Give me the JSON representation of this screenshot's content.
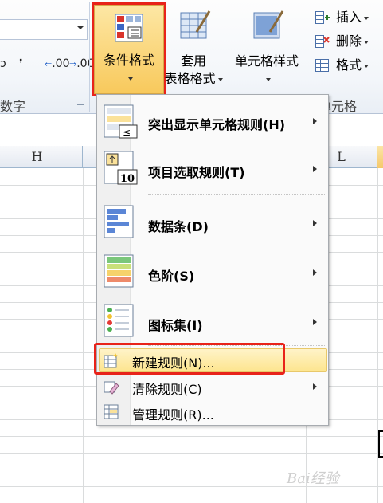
{
  "ribbon": {
    "number_group_label": "数字",
    "increase_decimal": ".00",
    "decrease_decimal": ".00",
    "comma_glyph": "❜",
    "conditional_format": {
      "label": "条件格式"
    },
    "format_as_table": {
      "label_line1": "套用",
      "label_line2": "表格格式"
    },
    "cell_styles": {
      "label": "单元格样式"
    },
    "cells_group_label": "单元格",
    "insert_label": "插入",
    "delete_label": "删除",
    "format_label": "格式"
  },
  "sheet": {
    "columns": [
      "H",
      "L"
    ],
    "highlight_color": "#f5c86a"
  },
  "menu": {
    "items": [
      {
        "label": "突出显示单元格规则(H)",
        "icon": "highlight-rules-icon",
        "has_submenu": true
      },
      {
        "label": "项目选取规则(T)",
        "icon": "top-bottom-rules-icon",
        "has_submenu": true
      },
      {
        "label": "数据条(D)",
        "icon": "data-bars-icon",
        "has_submenu": true
      },
      {
        "label": "色阶(S)",
        "icon": "color-scales-icon",
        "has_submenu": true
      },
      {
        "label": "图标集(I)",
        "icon": "icon-sets-icon",
        "has_submenu": true
      },
      {
        "label": "新建规则(N)...",
        "icon": "new-rule-icon",
        "has_submenu": false
      },
      {
        "label": "清除规则(C)",
        "icon": "clear-rules-icon",
        "has_submenu": true
      },
      {
        "label": "管理规则(R)...",
        "icon": "manage-rules-icon",
        "has_submenu": false
      }
    ]
  },
  "colors": {
    "accent_red": "#e8231a",
    "hover": "#fde58f"
  },
  "watermark": "Bai经验"
}
